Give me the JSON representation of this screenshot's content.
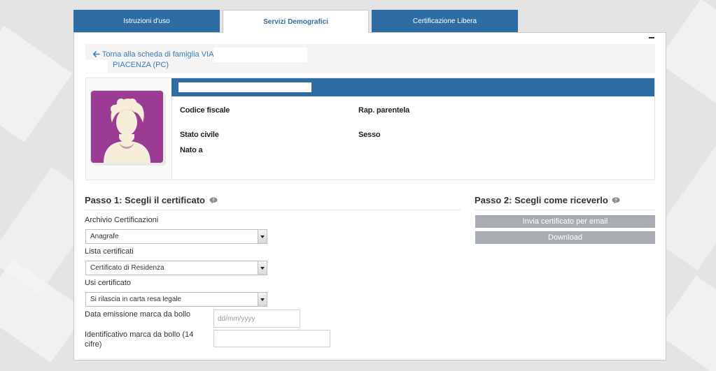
{
  "tabs": [
    {
      "label": "Istruzioni d'uso",
      "active": false
    },
    {
      "label": "Servizi Demografici",
      "active": true
    },
    {
      "label": "Certificazione Libera",
      "active": false
    }
  ],
  "back_link": {
    "line1": "Torna alla scheda di famiglia VIA",
    "line2": "PIACENZA (PC)"
  },
  "profile": {
    "codice_fiscale_label": "Codice fiscale",
    "rap_parentela_label": "Rap. parentela",
    "stato_civile_label": "Stato civile",
    "sesso_label": "Sesso",
    "nato_a_label": "Nato a"
  },
  "step1": {
    "title": "Passo 1: Scegli il certificato",
    "archivio_label": "Archivio Certificazioni",
    "archivio_value": "Anagrafe",
    "lista_label": "Lista certificati",
    "lista_value": "Certificato di Residenza",
    "usi_label": "Usi certificato",
    "usi_value": "Si rilascia in carta resa legale",
    "data_label": "Data emissione marca da bollo",
    "data_placeholder": "dd/mm/yyyy",
    "data_value": "",
    "id_label": "Identificativo marca da bollo (14 cifre)",
    "id_value": ""
  },
  "step2": {
    "title": "Passo 2: Scegli come riceverlo",
    "email_button": "Invia certificato per email",
    "download_button": "Download"
  },
  "colors": {
    "primary": "#2e6da4",
    "avatar_bg": "#9c3b94",
    "button_disabled": "#a8adb3"
  },
  "icons": [
    "arrow-left-icon",
    "help-bubble-icon",
    "female-avatar-icon",
    "chevron-down-icon",
    "minimize-icon"
  ]
}
